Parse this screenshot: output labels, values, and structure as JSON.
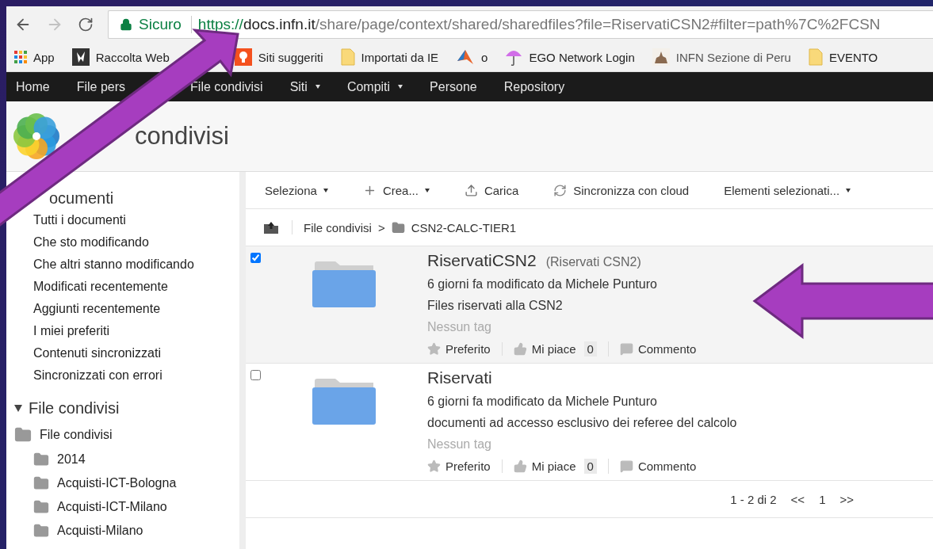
{
  "address_bar": {
    "secure_label": "Sicuro",
    "url_scheme": "https://",
    "url_host": "docs.infn.it",
    "url_path": "/share/page/context/shared/sharedfiles?file=RiservatiCSN2#filter=path%7C%2FCSN"
  },
  "bookmarks": [
    {
      "label": "App",
      "kind": "apps"
    },
    {
      "label": "Raccolta Web",
      "kind": "dark"
    },
    {
      "label": "Siti suggeriti",
      "kind": "bulb"
    },
    {
      "label": "Importati da IE",
      "kind": "folder"
    },
    {
      "label": "o",
      "kind": "cone"
    },
    {
      "label": "EGO Network Login",
      "kind": "umbrella"
    },
    {
      "label": "INFN Sezione di Peru",
      "kind": "photo"
    },
    {
      "label": "EVENTO",
      "kind": "folder"
    }
  ],
  "nav": [
    {
      "label": "Home",
      "dropdown": false
    },
    {
      "label": "File pers",
      "dropdown": false
    },
    {
      "label": "File condivisi",
      "dropdown": false
    },
    {
      "label": "Siti",
      "dropdown": true
    },
    {
      "label": "Compiti",
      "dropdown": true
    },
    {
      "label": "Persone",
      "dropdown": false
    },
    {
      "label": "Repository",
      "dropdown": false
    }
  ],
  "page_title": "condivisi",
  "sidebar": {
    "section": "ocumenti",
    "items": [
      "Tutti i documenti",
      "Che sto modificando",
      "Che altri stanno modificando",
      "Modificati recentemente",
      "Aggiunti recentemente",
      "I miei preferiti",
      "Contenuti sincronizzati",
      "Sincronizzati con errori"
    ],
    "tree": {
      "label": "File condivisi",
      "expanded": true,
      "children": [
        {
          "label": "File condivisi",
          "children": [
            {
              "label": "2014"
            },
            {
              "label": "Acquisti-ICT-Bologna"
            },
            {
              "label": "Acquisti-ICT-Milano"
            },
            {
              "label": "Acquisti-Milano"
            }
          ]
        }
      ]
    }
  },
  "toolbar": [
    {
      "label": "Seleziona",
      "kind": "menu"
    },
    {
      "label": "Crea...",
      "kind": "create"
    },
    {
      "label": "Carica",
      "kind": "upload"
    },
    {
      "label": "Sincronizza con cloud",
      "kind": "sync"
    },
    {
      "label": "Elementi selezionati...",
      "kind": "menu"
    }
  ],
  "breadcrumb": {
    "parent": "File condivisi",
    "separator": ">",
    "current": "CSN2-CALC-TIER1"
  },
  "rows": [
    {
      "name": "RiservatiCSN2",
      "title": "(Riservati CSN2)",
      "modified": "6 giorni fa modificato da Michele Punturo",
      "description": "Files riservati alla CSN2",
      "tags": "Nessun tag",
      "favorite": "Preferito",
      "like": "Mi piace",
      "like_count": "0",
      "comment": "Commento",
      "selected": true
    },
    {
      "name": "Riservati",
      "modified": "6 giorni fa modificato da Michele Punturo",
      "description": "documenti ad accesso esclusivo dei referee del calcolo",
      "tags": "Nessun tag",
      "favorite": "Preferito",
      "like": "Mi piace",
      "like_count": "0",
      "comment": "Commento",
      "selected": false
    }
  ],
  "pager": {
    "summary": "1 - 2 di 2",
    "prev": "<<",
    "page": "1",
    "next": ">>"
  }
}
